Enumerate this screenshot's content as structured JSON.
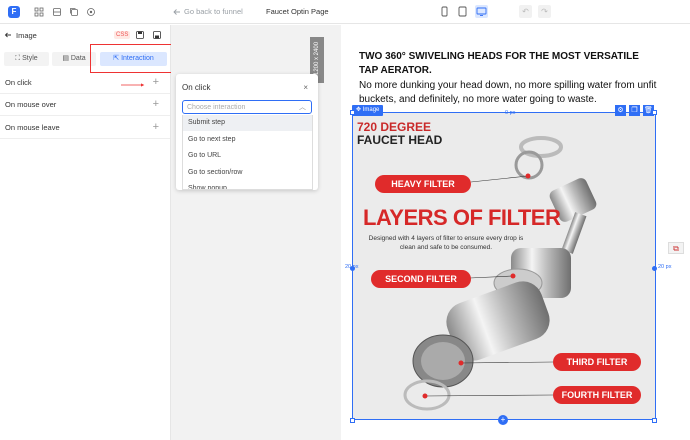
{
  "topbar": {
    "logo": "F",
    "back_label": "Go back to funnel",
    "page_title": "Faucet Optin Page"
  },
  "left_panel": {
    "header": "Image",
    "css_badge": "CSS",
    "tabs": [
      {
        "label": "Style"
      },
      {
        "label": "Data"
      },
      {
        "label": "Interaction"
      }
    ],
    "events": [
      {
        "label": "On click"
      },
      {
        "label": "On mouse over"
      },
      {
        "label": "On mouse leave"
      }
    ],
    "add_symbol": "+"
  },
  "popup": {
    "title": "On click",
    "close": "×",
    "placeholder": "Choose interaction",
    "chevron": "︿",
    "options": [
      "Submit step",
      "Go to next step",
      "Go to URL",
      "Go to section/row",
      "Show popup"
    ]
  },
  "ruler_label": "1200 x 2400",
  "canvas": {
    "heading": "TWO 360° SWIVELING HEADS FOR THE MOST VERSATILE TAP AERATOR.",
    "body": "No more dunking your head down, no more spilling water from unfit buckets, and definitely, no more water going to waste.",
    "image_badge": "Image",
    "dim_top": "0 px",
    "dim_left": "20 px",
    "dim_right": "20 px"
  },
  "infographic": {
    "title_line1": "720 DEGREE",
    "title_line2": "FAUCET HEAD",
    "heavy_filter": "HEAVY FILTER",
    "layers_title": "LAYERS OF FILTER",
    "description": "Designed with 4 layers of filter to ensure every drop is clean and safe to be consumed.",
    "second_filter": "SECOND FILTER",
    "third_filter": "THIRD FILTER",
    "fourth_filter": "FOURTH FILTER"
  },
  "colors": {
    "accent": "#2f6ef5",
    "red": "#e02b2b",
    "panel_bg": "#f2f2f2"
  }
}
